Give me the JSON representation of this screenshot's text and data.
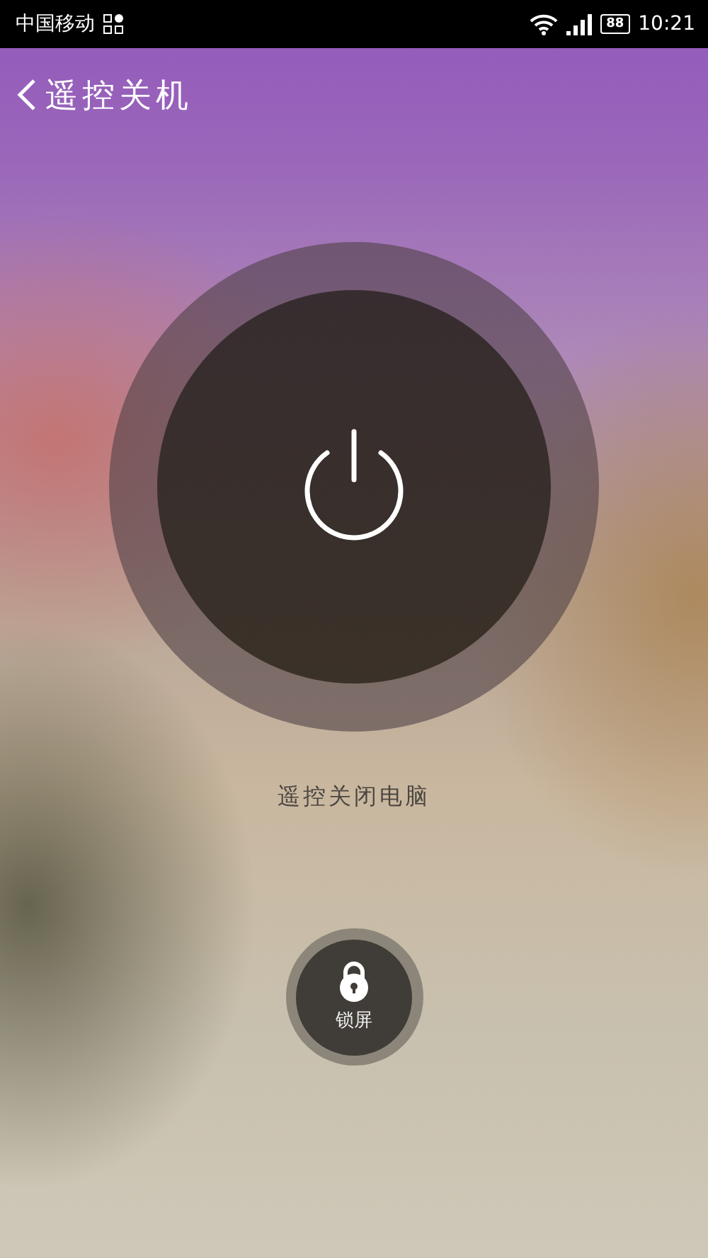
{
  "status_bar": {
    "carrier": "中国移动",
    "battery": "88",
    "time": "10:21"
  },
  "header": {
    "title": "遥控关机"
  },
  "power": {
    "label": "遥控关闭电脑"
  },
  "lock": {
    "label": "锁屏"
  }
}
